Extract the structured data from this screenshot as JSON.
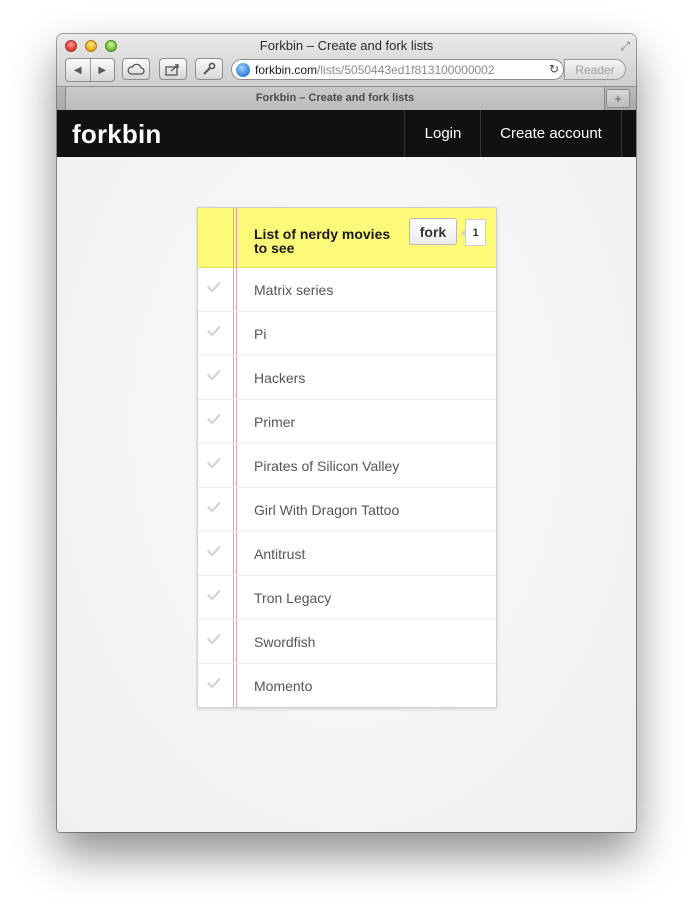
{
  "window": {
    "title": "Forkbin – Create and fork lists",
    "tab_title": "Forkbin – Create and fork lists",
    "new_tab_label": "+",
    "url_host": "forkbin.com",
    "url_path": "/lists/5050443ed1f813100000002",
    "reader_label": "Reader"
  },
  "site": {
    "brand": "forkbin",
    "nav": [
      "Login",
      "Create account"
    ]
  },
  "list": {
    "title": "List of nerdy movies to see",
    "fork_label": "fork",
    "fork_count": "1",
    "items": [
      "Matrix series",
      "Pi",
      "Hackers",
      "Primer",
      "Pirates of Silicon Valley",
      "Girl With Dragon Tattoo",
      "Antitrust",
      "Tron Legacy",
      "Swordfish",
      "Momento"
    ]
  },
  "colors": {
    "header_yellow": "#fff97a",
    "navbar": "#111111",
    "margin_line": "#e4a3a3"
  }
}
